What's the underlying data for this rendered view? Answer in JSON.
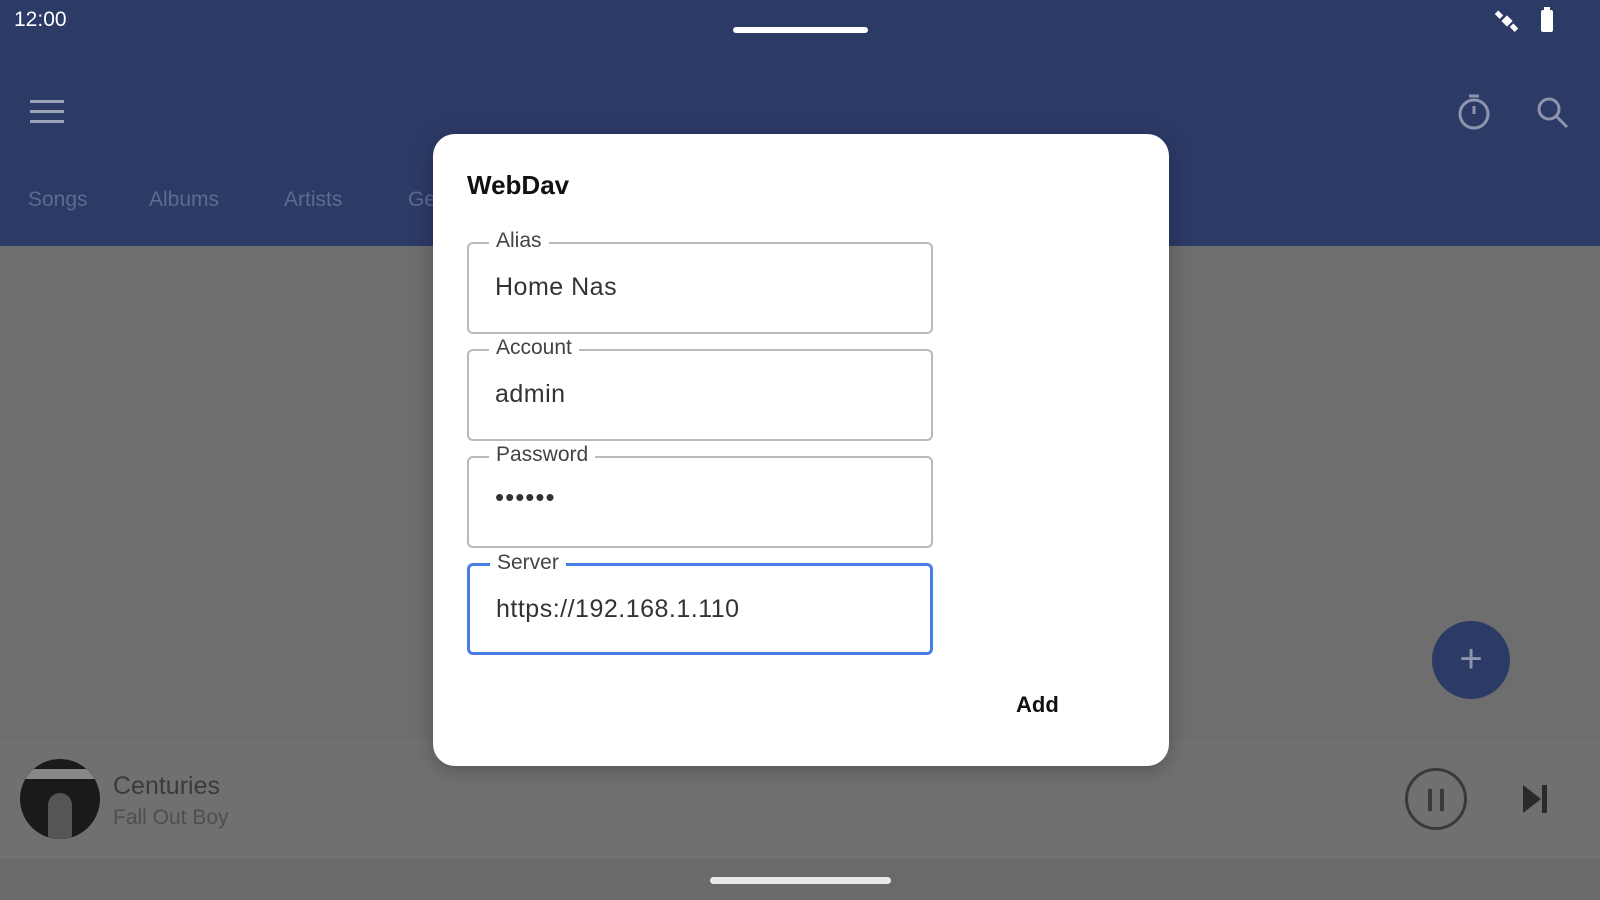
{
  "status_bar": {
    "time": "12:00"
  },
  "tabs": [
    "Songs",
    "Albums",
    "Artists",
    "Ge"
  ],
  "fab": {
    "symbol": "+"
  },
  "player": {
    "title": "Centuries",
    "artist": "Fall Out Boy"
  },
  "dialog": {
    "title": "WebDav",
    "fields": [
      {
        "label": "Alias",
        "value": "Home Nas"
      },
      {
        "label": "Account",
        "value": "admin"
      },
      {
        "label": "Password",
        "value": "••••••"
      },
      {
        "label": "Server",
        "value": "https://192.168.1.110"
      }
    ],
    "add_label": "Add"
  },
  "colors": {
    "app_bar": "#2c3a66",
    "focus": "#4a7ee6"
  }
}
